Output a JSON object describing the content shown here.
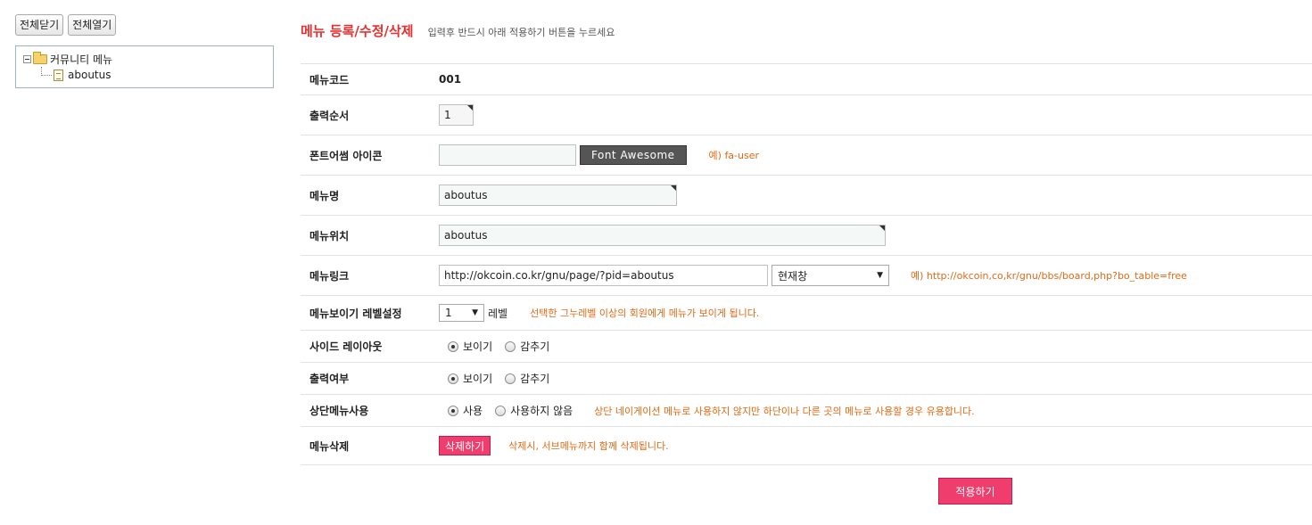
{
  "tree": {
    "collapse_all_label": "전체닫기",
    "expand_all_label": "전체열기",
    "root_label": "커뮤니티 메뉴",
    "child_label": "aboutus"
  },
  "form": {
    "title": "메뉴 등록/수정/삭제",
    "description": "입력후 반드시 아래 적용하기 버튼을 누르세요",
    "rows": {
      "code": {
        "label": "메뉴코드",
        "value": "001"
      },
      "order": {
        "label": "출력순서",
        "value": "1"
      },
      "icon": {
        "label": "폰트어썸 아이콘",
        "value": "",
        "button_label": "Font Awesome",
        "hint": "예) fa-user"
      },
      "name": {
        "label": "메뉴명",
        "value": "aboutus"
      },
      "location": {
        "label": "메뉴위치",
        "value": "aboutus"
      },
      "link": {
        "label": "메뉴링크",
        "value": "http://okcoin.co.kr/gnu/page/?pid=aboutus",
        "target_selected": "현재창",
        "hint": "예) http://okcoin,co,kr/gnu/bbs/board,php?bo_table=free"
      },
      "level": {
        "label": "메뉴보이기 레벨설정",
        "selected": "1",
        "unit": "레벨",
        "hint": "선택한 그누레벨 이상의 회원에게 메뉴가 보이게 됩니다."
      },
      "side_layout": {
        "label": "사이드 레이아웃",
        "option_show": "보이기",
        "option_hide": "감추기"
      },
      "output": {
        "label": "출력여부",
        "option_show": "보이기",
        "option_hide": "감추기"
      },
      "top_menu": {
        "label": "상단메뉴사용",
        "option_use": "사용",
        "option_nouse": "사용하지 않음",
        "hint": "상단 네이게이션 메뉴로 사용하지 않지만 하단이나 다른 곳의 메뉴로 사용할 경우 유용합니다."
      },
      "delete": {
        "label": "메뉴삭제",
        "button_label": "삭제하기",
        "hint": "삭제시, 서브메뉴까지 함께 삭제됩니다."
      }
    },
    "apply_label": "적용하기"
  }
}
